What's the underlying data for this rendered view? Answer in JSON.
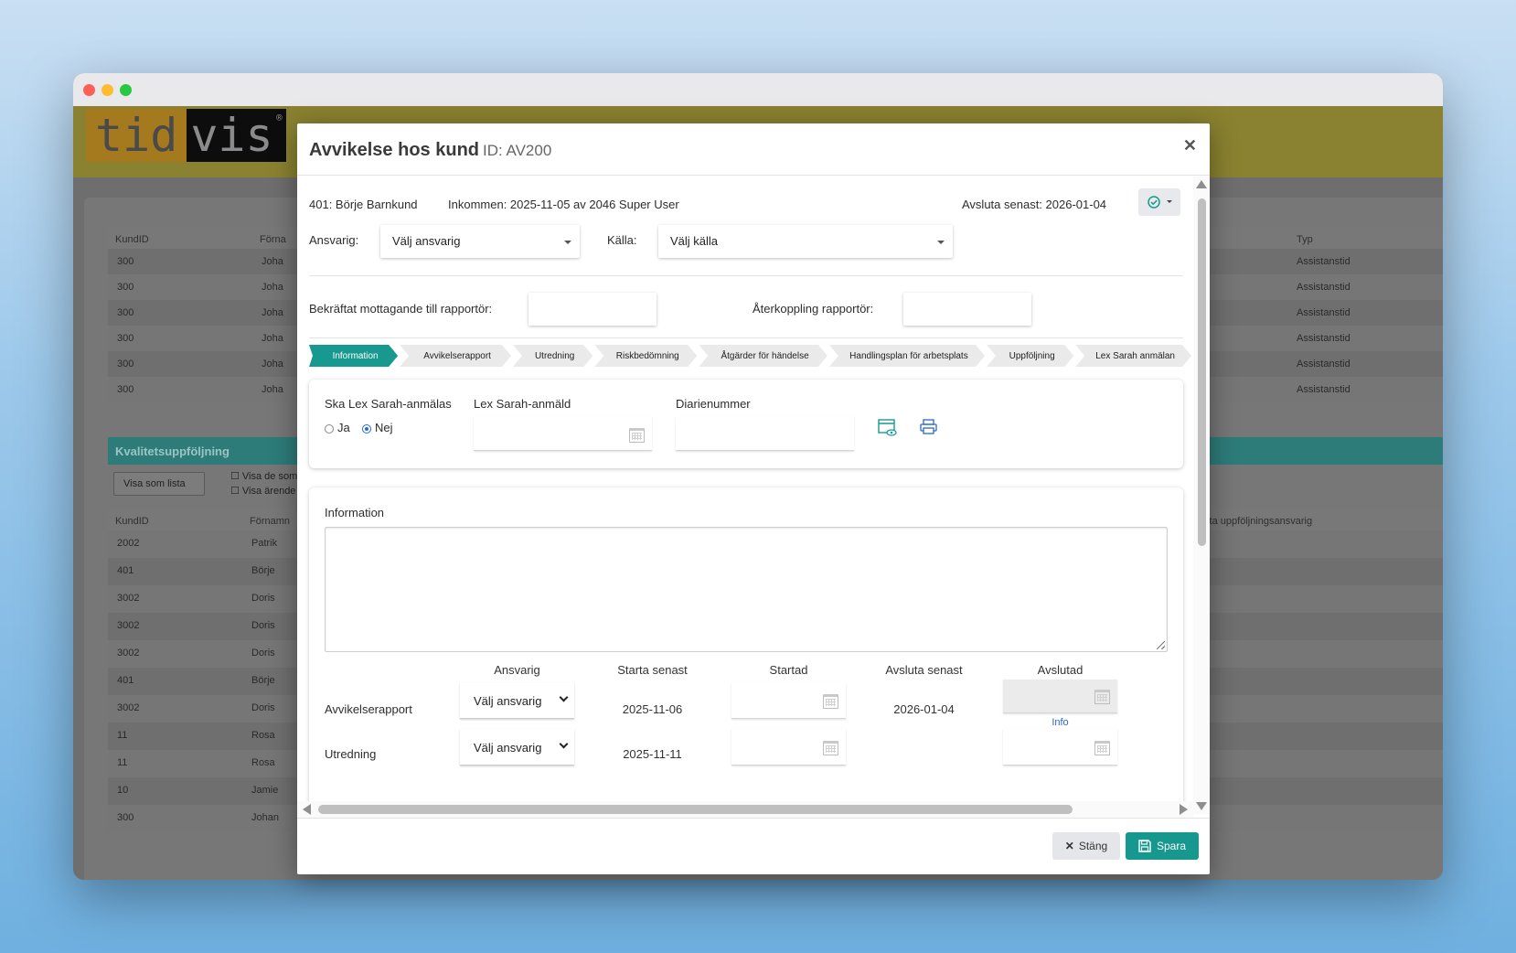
{
  "app": {
    "logo_left": "tid",
    "logo_right": "vis",
    "logo_mark": "®"
  },
  "background": {
    "table1": {
      "headers": [
        "KundID",
        "Förna",
        "Typ"
      ],
      "rows": [
        [
          "300",
          "Joha",
          "Assistanstid"
        ],
        [
          "300",
          "Joha",
          "Assistanstid"
        ],
        [
          "300",
          "Joha",
          "Assistanstid"
        ],
        [
          "300",
          "Joha",
          "Assistanstid"
        ],
        [
          "300",
          "Joha",
          "Assistanstid"
        ],
        [
          "300",
          "Joha",
          "Assistanstid"
        ]
      ]
    },
    "section_title": "Kvalitetsuppföljning",
    "view_select": "Visa som lista",
    "check1": "Visa de som",
    "check2": "Visa ärende",
    "table2": {
      "headers": [
        "KundID",
        "Förnamn",
        "Nästa uppföljningsansvarig"
      ],
      "rows": [
        [
          "2002",
          "Patrik"
        ],
        [
          "401",
          "Börje"
        ],
        [
          "3002",
          "Doris"
        ],
        [
          "3002",
          "Doris"
        ],
        [
          "3002",
          "Doris"
        ],
        [
          "401",
          "Börje"
        ],
        [
          "3002",
          "Doris"
        ],
        [
          "11",
          "Rosa"
        ],
        [
          "11",
          "Rosa"
        ],
        [
          "10",
          "Jamie"
        ],
        [
          "300",
          "Johan"
        ]
      ]
    }
  },
  "modal": {
    "title": "Avvikelse hos kund",
    "id_label": "ID: AV200",
    "customer": "401: Börje Barnkund",
    "received": "Inkommen: 2025-11-05 av 2046 Super User",
    "deadline": "Avsluta senast: 2026-01-04",
    "responsible_label": "Ansvarig:",
    "responsible_value": "Välj ansvarig",
    "source_label": "Källa:",
    "source_value": "Välj källa",
    "confirmed_label": "Bekräftat mottagande till rapportör:",
    "feedback_label": "Återkoppling rapportör:",
    "steps": [
      "Information",
      "Avvikelserapport",
      "Utredning",
      "Riskbedömning",
      "Åtgärder för händelse",
      "Handlingsplan för arbetsplats",
      "Uppföljning",
      "Lex Sarah anmälan"
    ],
    "lex": {
      "question": "Ska Lex Sarah-anmälas",
      "yes": "Ja",
      "no": "Nej",
      "reported_label": "Lex Sarah-anmäld",
      "diary_label": "Diarienummer"
    },
    "info": {
      "label": "Information",
      "columns": [
        "Ansvarig",
        "Starta senast",
        "Startad",
        "Avsluta senast",
        "Avslutad"
      ],
      "rows": [
        {
          "name": "Avvikelserapport",
          "responsible": "Välj ansvarig",
          "start_by": "2025-11-06",
          "end_by": "2026-01-04",
          "info_link": "Info"
        },
        {
          "name": "Utredning",
          "responsible": "Välj ansvarig",
          "start_by": "2025-11-11",
          "end_by": ""
        }
      ]
    },
    "buttons": {
      "close": "Stäng",
      "save": "Spara"
    }
  },
  "colors": {
    "accent": "#17998f",
    "topbar": "#8a8230"
  }
}
